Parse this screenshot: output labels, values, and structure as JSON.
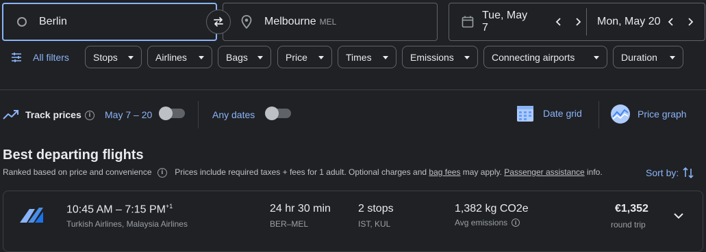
{
  "search": {
    "origin": "Berlin",
    "destination": "Melbourne",
    "destination_code": "MEL",
    "depart_date": "Tue, May 7",
    "return_date": "Mon, May 20"
  },
  "filters": {
    "all_filters_label": "All filters",
    "chips": [
      "Stops",
      "Airlines",
      "Bags",
      "Price",
      "Times",
      "Emissions",
      "Connecting airports",
      "Duration"
    ]
  },
  "tracking": {
    "track_prices_label": "Track prices",
    "date_range": "May 7 – 20",
    "any_dates_label": "Any dates",
    "date_grid_label": "Date grid",
    "price_graph_label": "Price graph"
  },
  "results": {
    "heading": "Best departing flights",
    "ranked_text": "Ranked based on price and convenience",
    "prices_text_1": "Prices include required taxes + fees for 1 adult. Optional charges and ",
    "bag_fees_link": "bag fees",
    "prices_text_2": " may apply. ",
    "passenger_link": "Passenger assistance",
    "prices_text_3": " info.",
    "sort_label": "Sort by:"
  },
  "flight": {
    "times": "10:45 AM – 7:15 PM",
    "day_offset": "+1",
    "airlines": "Turkish Airlines, Malaysia Airlines",
    "duration": "24 hr 30 min",
    "route": "BER–MEL",
    "stops": "2 stops",
    "stop_airports": "IST, KUL",
    "emissions": "1,382 kg CO2e",
    "emissions_label": "Avg emissions",
    "price": "€1,352",
    "price_label": "round trip"
  },
  "colors": {
    "background": "#202124",
    "accent": "#8ab4f8",
    "border": "#5f6368",
    "text": "#e8eaed",
    "subtext": "#9aa0a6"
  }
}
